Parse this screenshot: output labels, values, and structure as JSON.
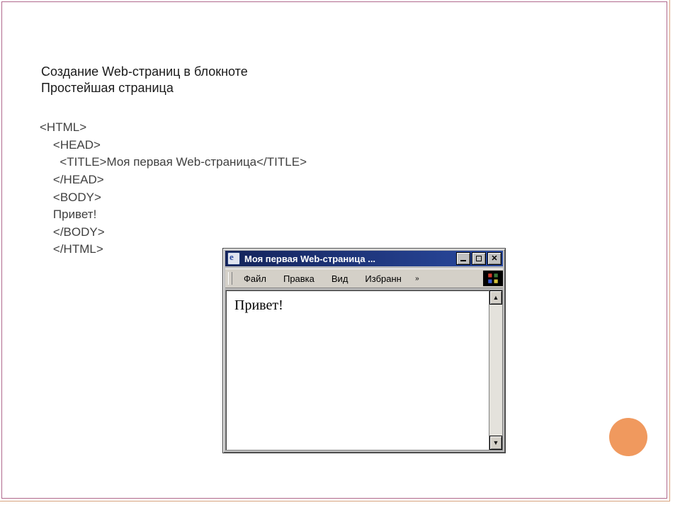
{
  "heading": {
    "line1": "Создание Web-страниц в блокноте",
    "line2": "Простейшая страница"
  },
  "code": {
    "l1": "<HTML>",
    "l2": "    <HEAD>",
    "l3": "      <TITLE>Моя первая Web-страница</TITLE>",
    "l4": "    </HEAD>",
    "l5": "    <BODY>",
    "l6": "    Привет!",
    "l7": "    </BODY>",
    "l8": "    </HTML>"
  },
  "browser": {
    "title": "Моя первая Web-страница ...",
    "menu": {
      "file": "Файл",
      "edit": "Правка",
      "view": "Вид",
      "favorites": "Избранн",
      "overflow": "»"
    },
    "page_body": "Привет!"
  }
}
